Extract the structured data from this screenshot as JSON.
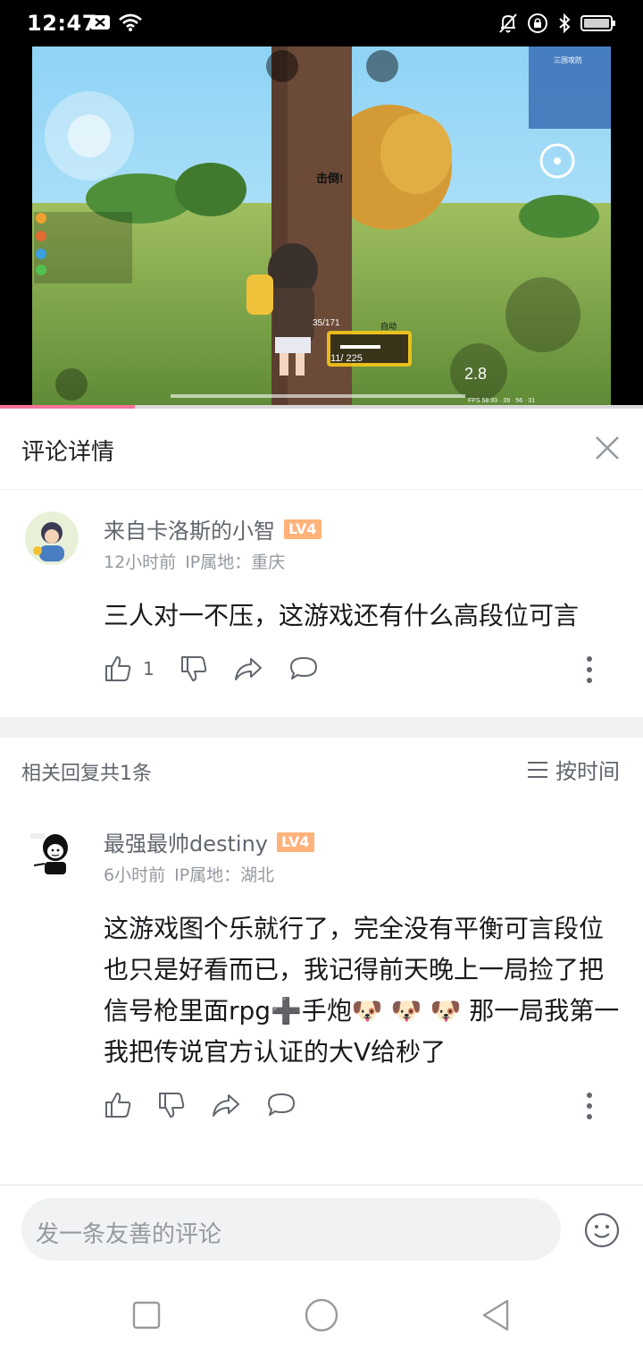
{
  "status_bar": {
    "time": "12:47",
    "left_icons": [
      "message-icon",
      "wifi-icon"
    ],
    "right_icons": [
      "mute-bell-icon",
      "lock-rotation-icon",
      "bluetooth-icon",
      "battery-icon"
    ]
  },
  "video": {
    "progress": 0.21,
    "hud_texts": {
      "hit_banner": "击倒!",
      "ammo_clip": "35/171",
      "weapon_mode": "自动",
      "ammo_count": "11/ 225",
      "fps": "FPS 58.93 · 39 · 56 · 31",
      "skill_timer": "2.8",
      "mission": "三国攻防"
    }
  },
  "panel": {
    "title": "评论详情",
    "close_icon": "close-icon"
  },
  "main_comment": {
    "username": "来自卡洛斯的小智",
    "level": "LV4",
    "time": "12小时前",
    "location": "IP属地：重庆",
    "text": "三人对一不压，这游戏还有什么高段位可言",
    "like_count": "1"
  },
  "replies_header": {
    "count_label": "相关回复共1条",
    "sort_label": "按时间"
  },
  "reply": {
    "username": "最强最帅destiny",
    "level": "LV4",
    "time": "6小时前",
    "location": "IP属地：湖北",
    "text": "这游戏图个乐就行了，完全没有平衡可言段位也只是好看而已，我记得前天晚上一局捡了把信号枪里面rpg➕手炮🐶 🐶 🐶 那一局我第一我把传说官方认证的大V给秒了"
  },
  "input": {
    "placeholder": "发一条友善的评论"
  },
  "colors": {
    "accent": "#fb7299",
    "level_badge": "#ffb27a",
    "text_primary": "#18191c",
    "text_secondary": "#9499a0"
  }
}
